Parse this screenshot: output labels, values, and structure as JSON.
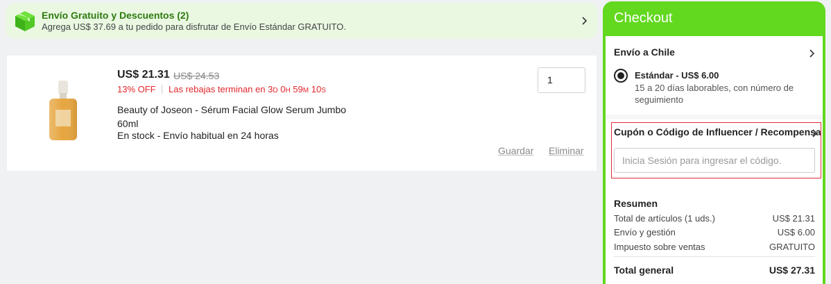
{
  "banner": {
    "title": "Envío Gratuito y Descuentos (2)",
    "subtitle": "Agrega US$ 37.69 a tu pedido para disfrutar de Envío Estándar GRATUITO."
  },
  "product": {
    "price": "US$ 21.31",
    "old_price": "US$ 24.53",
    "discount": "13% OFF",
    "sale_label": "Las rebajas terminan en",
    "countdown": {
      "d": "3",
      "d_unit": "D",
      "h": "0",
      "h_unit": "H",
      "m": "59",
      "m_unit": "M",
      "s": "10",
      "s_unit": "S"
    },
    "name": "Beauty of Joseon - Sérum Facial Glow Serum Jumbo 60ml",
    "stock": "En stock - Envío habitual en 24 horas",
    "quantity": "1",
    "save_label": "Guardar",
    "remove_label": "Eliminar"
  },
  "checkout": {
    "title": "Checkout",
    "shipping_title": "Envío a Chile",
    "standard_label": "Estándar - US$ 6.00",
    "standard_desc": "15 a 20 días laborables, con número de seguimiento",
    "coupon_title": "Cupón o Código de Influencer / Recompensa",
    "coupon_placeholder": "Inicia Sesión para ingresar el código.",
    "summary_title": "Resumen",
    "rows": [
      {
        "label": "Total de artículos (1 uds.)",
        "value": "US$ 21.31"
      },
      {
        "label": "Envío y gestión",
        "value": "US$ 6.00"
      },
      {
        "label": "Impuesto sobre ventas",
        "value": "GRATUITO"
      }
    ],
    "total_label": "Total general",
    "total_value": "US$ 27.31"
  },
  "colors": {
    "accent": "#62d81f",
    "sale": "#e3262b",
    "banner_bg": "#eaf8e2",
    "highlight": "#e02c3a"
  }
}
